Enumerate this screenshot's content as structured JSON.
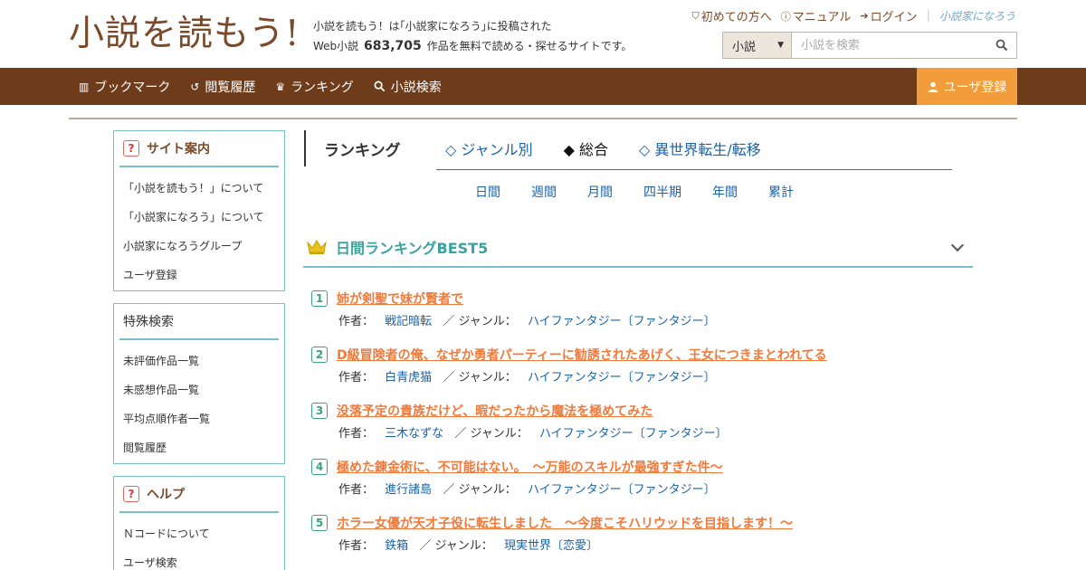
{
  "header": {
    "logo": "小説を読もう!",
    "tagline_line1": "小説を読もう！は｢小説家になろう｣に投稿された",
    "tagline_prefix": "Web小説",
    "tagline_count": "683,705",
    "tagline_suffix": "作品を無料で読める・探せるサイトです。",
    "links": [
      {
        "label": "初めての方へ",
        "icon": "guide-icon"
      },
      {
        "label": "マニュアル",
        "icon": "help-circle-icon"
      },
      {
        "label": "ログイン",
        "icon": "login-icon"
      }
    ],
    "brand_link": "小説家になろう",
    "search": {
      "select_value": "小説",
      "placeholder": "小説を検索"
    }
  },
  "nav": {
    "items": [
      {
        "label": "ブックマーク",
        "icon": "bookmark-icon"
      },
      {
        "label": "閲覧履歴",
        "icon": "history-icon"
      },
      {
        "label": "ランキング",
        "icon": "crown-icon"
      },
      {
        "label": "小説検索",
        "icon": "search-icon"
      }
    ],
    "register": "ユーザ登録"
  },
  "sidebar": {
    "site_guide": {
      "title": "サイト案内",
      "items": [
        "「小説を読もう！」について",
        "「小説家になろう」について",
        "小説家になろうグループ",
        "ユーザ登録"
      ]
    },
    "special_search": {
      "title": "特殊検索",
      "items": [
        "未評価作品一覧",
        "未感想作品一覧",
        "平均点順作者一覧",
        "閲覧履歴"
      ]
    },
    "help": {
      "title": "ヘルプ",
      "items": [
        "Ｎコードについて",
        "ユーザ検索"
      ]
    }
  },
  "ranking": {
    "heading": "ランキング",
    "tabs": [
      {
        "label": "◇ ジャンル別",
        "active": false
      },
      {
        "label": "◆ 総合",
        "active": true
      },
      {
        "label": "◇ 異世界転生/転移",
        "active": false
      }
    ],
    "periods": [
      "日間",
      "週間",
      "月間",
      "四半期",
      "年間",
      "累計"
    ],
    "best_title": "日間ランキングBEST5",
    "author_label": "作者：",
    "genre_label": "／ ジャンル：",
    "entries": [
      {
        "rank": "1",
        "title": "姉が剣聖で妹が賢者で",
        "author": "戦記暗転",
        "genre": "ハイファンタジー〔ファンタジー〕"
      },
      {
        "rank": "2",
        "title": "D級冒険者の俺、なぜか勇者パーティーに勧誘されたあげく、王女につきまとわれてる",
        "author": "白青虎猫",
        "genre": "ハイファンタジー〔ファンタジー〕"
      },
      {
        "rank": "3",
        "title": "没落予定の貴族だけど、暇だったから魔法を極めてみた",
        "author": "三木なずな",
        "genre": "ハイファンタジー〔ファンタジー〕"
      },
      {
        "rank": "4",
        "title": "極めた錬金術に、不可能はない。　～万能のスキルが最強すぎた件～",
        "author": "進行諸島",
        "genre": "ハイファンタジー〔ファンタジー〕"
      },
      {
        "rank": "5",
        "title": "ホラー女優が天才子役に転生しました　～今度こそハリウッドを目指します！～",
        "author": "鉄箱",
        "genre": "現実世界〔恋愛〕"
      }
    ]
  },
  "colors": {
    "nav_bg": "#6e3c1b",
    "register_bg": "#f39c3b",
    "logo": "#7b4a2a",
    "accent_teal": "#3aa3a0",
    "title_orange": "#f07a3c",
    "link_blue": "#1a63a8"
  }
}
